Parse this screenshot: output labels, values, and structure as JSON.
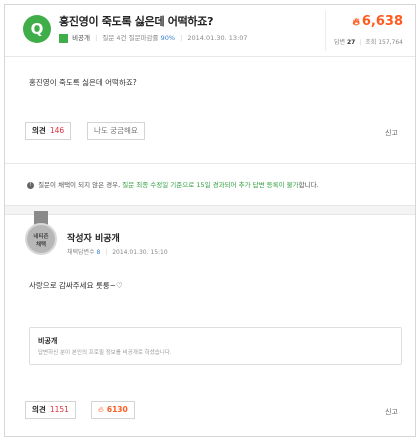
{
  "question": {
    "icon_letter": "Q",
    "title": "홍진영이 죽도록 싫은데 어떡하죠?",
    "author": "비공개",
    "stats_label": "질문 4건 질문마감률",
    "close_rate": "90%",
    "date": "2014.01.30. 13:07",
    "point": "6,638",
    "answers_label": "답변",
    "answers_count": "27",
    "views_label": "조회",
    "views_count": "157,764",
    "body": "홍진영이 죽도록 싫은데 어떡하죠?",
    "opinion_label": "의견",
    "opinion_count": "146",
    "also_curious": "나도 궁금해요",
    "report": "신고"
  },
  "notice": {
    "prefix": "질문이 채택이 되지 않은 경우,",
    "highlight": "질문 최종 수정일 기준으로 15일 경과되어 추가 답변 등록이 불가",
    "suffix": "합니다."
  },
  "answer": {
    "medal_line1": "네티즌",
    "medal_line2": "채택",
    "author": "작성자 비공개",
    "adopt_label": "채택답변수",
    "adopt_count": "8",
    "date": "2014.01.30. 15:10",
    "body": "사랑으로 감싸주세요 룻룽~♡",
    "private_title": "비공개",
    "private_desc": "답변하신 분이 본인의 프로필 정보를 비공개로 하셨습니다.",
    "opinion_label": "의견",
    "opinion_count": "1151",
    "point": "6130",
    "report": "신고"
  },
  "colors": {
    "green": "#3fae49",
    "point_orange": "#ff5a1f",
    "opinion_red": "#e0303d",
    "link_blue": "#3a7fd0"
  },
  "icons": {
    "q_badge": "q-badge-icon",
    "fire": "fire-icon",
    "info": "info-icon",
    "medal": "medal-icon"
  }
}
